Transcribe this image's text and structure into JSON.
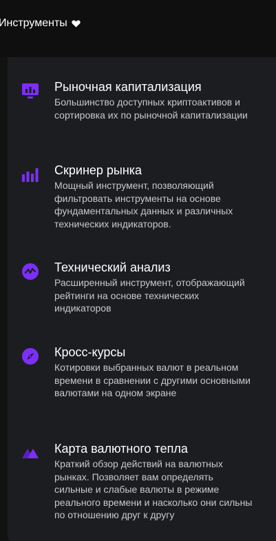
{
  "nav": {
    "label": "Инструменты"
  },
  "menu": {
    "items": [
      {
        "title": "Рыночная капитализация",
        "description": "Большинство доступных криптоактивов и сортировка их по рыночной капитализации",
        "icon": "monitor-chart-icon"
      },
      {
        "title": "Скринер рынка",
        "description": "Мощный инструмент, позволяющий фильтровать инструменты на основе фундаментальных данных и различных технических индикаторов.",
        "icon": "bar-chart-icon"
      },
      {
        "title": "Технический анализ",
        "description": "Расширенный инструмент, отображающий рейтинги на основе технических индикаторов",
        "icon": "pulse-circle-icon"
      },
      {
        "title": "Кросс-курсы",
        "description": "Котировки выбранных валют в реальном времени в сравнении с другими основными валютами на одном экране",
        "icon": "compass-icon"
      },
      {
        "title": "Карта валютного тепла",
        "description": "Краткий обзор действий на валютных рынках. Позволяет вам определять сильные и слабые валюты в режиме реального времени и насколько они сильны по отношению друг к другу",
        "icon": "mountains-icon"
      }
    ]
  },
  "colors": {
    "accent": "#7b2ff7",
    "accent_dark": "#5a1fc4",
    "panel_bg": "#1c1d21",
    "page_bg": "#121212"
  }
}
